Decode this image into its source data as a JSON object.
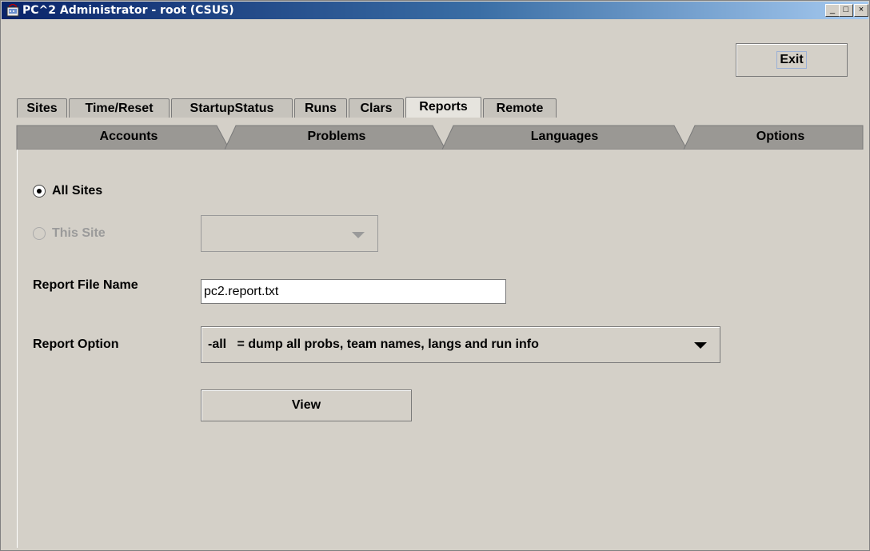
{
  "window": {
    "title": "PC^2 Administrator  - root (CSUS)",
    "controls": {
      "minimize": "_",
      "maximize": "□",
      "close": "×"
    }
  },
  "exit_label": "Exit",
  "tabs_row1": [
    {
      "label": "Sites",
      "selected": false
    },
    {
      "label": "Time/Reset",
      "selected": false
    },
    {
      "label": "StartupStatus",
      "selected": false
    },
    {
      "label": "Runs",
      "selected": false
    },
    {
      "label": "Clars",
      "selected": false
    },
    {
      "label": "Reports",
      "selected": true
    },
    {
      "label": "Remote",
      "selected": false
    }
  ],
  "tabs_row2": [
    {
      "label": "Accounts"
    },
    {
      "label": "Problems"
    },
    {
      "label": "Languages"
    },
    {
      "label": "Options"
    }
  ],
  "reports": {
    "all_sites_label": "All Sites",
    "all_sites_selected": true,
    "this_site_label": "This Site",
    "this_site_enabled": false,
    "site_value": "",
    "file_name_label": "Report File Name",
    "file_name_value": "pc2.report.txt",
    "option_label": "Report Option",
    "option_value": "-all   = dump all probs, team names, langs and run info",
    "view_label": "View"
  },
  "colors": {
    "titlebar_start": "#0a246a",
    "titlebar_end": "#a6caf0",
    "face": "#d4d0c8",
    "disabled_text": "#9a9a9a"
  }
}
